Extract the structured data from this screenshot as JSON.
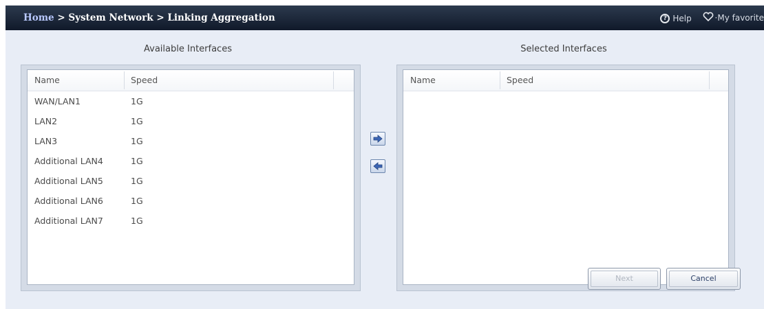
{
  "header": {
    "breadcrumb": {
      "home": "Home",
      "sep1": " > ",
      "section": "System Network",
      "sep2": " > ",
      "page": "Linking Aggregation"
    },
    "help_label": "Help",
    "favorite_label": "My favorite"
  },
  "available": {
    "title": "Available Interfaces",
    "columns": {
      "name": "Name",
      "speed": "Speed"
    },
    "rows": [
      {
        "name": "WAN/LAN1",
        "speed": "1G"
      },
      {
        "name": "LAN2",
        "speed": "1G"
      },
      {
        "name": "LAN3",
        "speed": "1G"
      },
      {
        "name": "Additional LAN4",
        "speed": "1G"
      },
      {
        "name": "Additional LAN5",
        "speed": "1G"
      },
      {
        "name": "Additional LAN6",
        "speed": "1G"
      },
      {
        "name": "Additional LAN7",
        "speed": "1G"
      }
    ]
  },
  "selected": {
    "title": "Selected Interfaces",
    "columns": {
      "name": "Name",
      "speed": "Speed"
    },
    "rows": []
  },
  "buttons": {
    "next": "Next",
    "cancel": "Cancel"
  },
  "icons": {
    "help": "question-circle-icon",
    "favorite": "heart-icon",
    "move_right": "arrow-right-icon",
    "move_left": "arrow-left-icon"
  }
}
